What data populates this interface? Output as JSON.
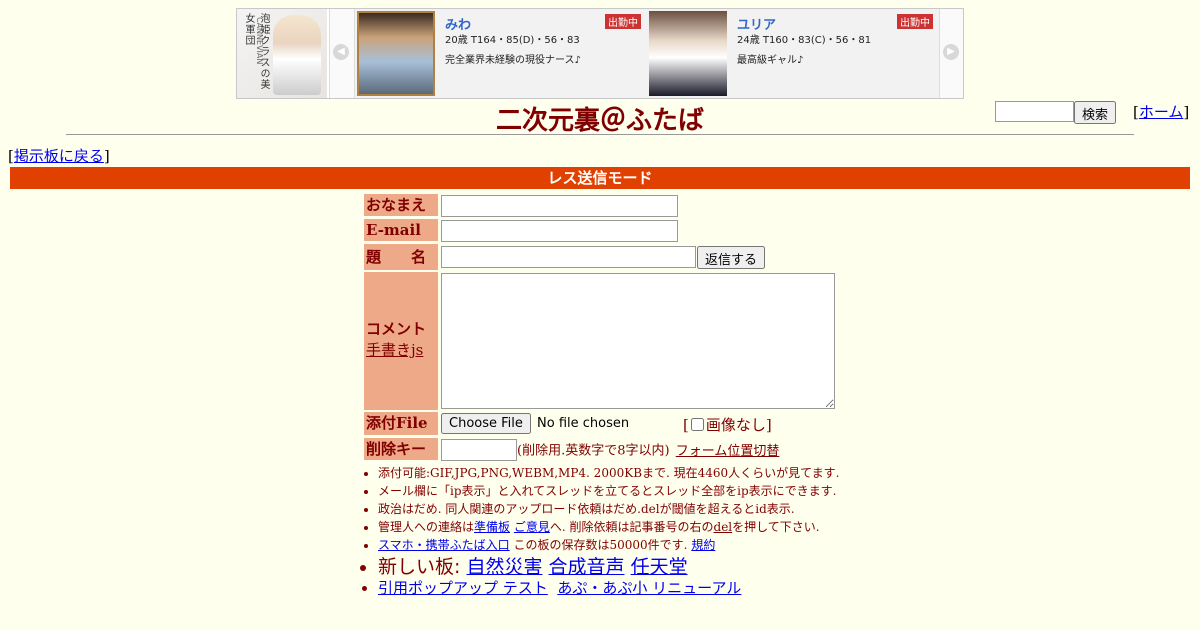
{
  "ad": {
    "logo_text_1": "泡姫クラスの美女軍団",
    "logo_text_2": "CANNEVIAN",
    "cards": [
      {
        "name": "みわ",
        "badge": "出勤中",
        "stats": "20歳 T164・85(D)・56・83",
        "copy": "完全業界未経験の現役ナース♪"
      },
      {
        "name": "ユリア",
        "badge": "出勤中",
        "stats": "24歳 T160・83(C)・56・81",
        "copy": "最高級ギャル♪"
      }
    ]
  },
  "header": {
    "title": "二次元裏＠ふたば",
    "search_button": "検索",
    "home_link": "ホーム",
    "back_link": "掲示板に戻る",
    "mode_banner": "レス送信モード"
  },
  "form": {
    "name_label": "おなまえ",
    "email_label": "E-mail",
    "subject_label": "題　　名",
    "submit_button": "返信する",
    "comment_label": "コメント",
    "handwrite_link": "手書きjs",
    "file_label": "添付File",
    "file_button": "Choose File",
    "file_status": "No file chosen",
    "no_image_label": "画像なし",
    "delkey_label": "削除キー",
    "delkey_note": "(削除用.英数字で8字以内)",
    "form_toggle_link": "フォーム位置切替"
  },
  "notes": {
    "n1": "添付可能:GIF,JPG,PNG,WEBM,MP4. 2000KBまで. 現在4460人くらいが見てます.",
    "n2": "メール欄に「ip表示」と入れてスレッドを立てるとスレッド全部をip表示にできます.",
    "n3": "政治はだめ. 同人関連のアップロード依頼はだめ.delが閾値を超えるとid表示.",
    "n4a": "管理人への連絡は",
    "n4_link1": "準備板",
    "n4_link2": "ご意見",
    "n4b": "へ. 削除依頼は記事番号の右の",
    "n4_del": "del",
    "n4c": "を押して下さい.",
    "n5_link": "スマホ・携帯ふたば入口",
    "n5_text": "この板の保存数は50000件です.",
    "n5_rules": "規約",
    "n6_prefix": "新しい板:",
    "n6_board1": "自然災害",
    "n6_board2": "合成音声",
    "n6_board3": "任天堂",
    "n7_link1": "引用ポップアップ テスト",
    "n7_link2": "あぷ・あぷ小 リニューアル"
  },
  "colors": {
    "background": "#ffffee",
    "text": "#800000",
    "mode_banner": "#e04000",
    "label_bg": "#eeaa88"
  }
}
